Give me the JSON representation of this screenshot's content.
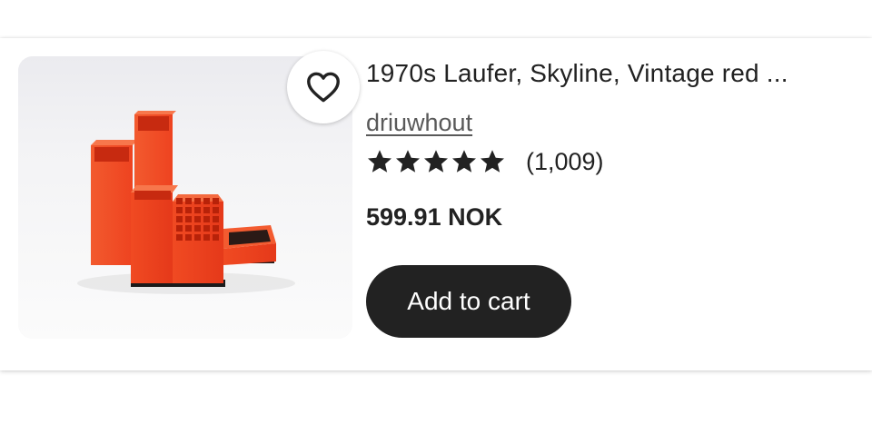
{
  "listing": {
    "title": "1970s Laufer, Skyline, Vintage red ...",
    "shop_name": "driuwhout",
    "rating": 5,
    "review_count": "(1,009)",
    "price": "599.91 NOK",
    "add_to_cart_label": "Add to cart",
    "favorite_icon": "heart-outline-icon",
    "star_icon": "star-filled-icon"
  },
  "colors": {
    "text": "#222222",
    "shop_link": "#595959",
    "button_bg": "#222222",
    "button_text": "#ffffff",
    "product_red": "#ee3a1a"
  }
}
